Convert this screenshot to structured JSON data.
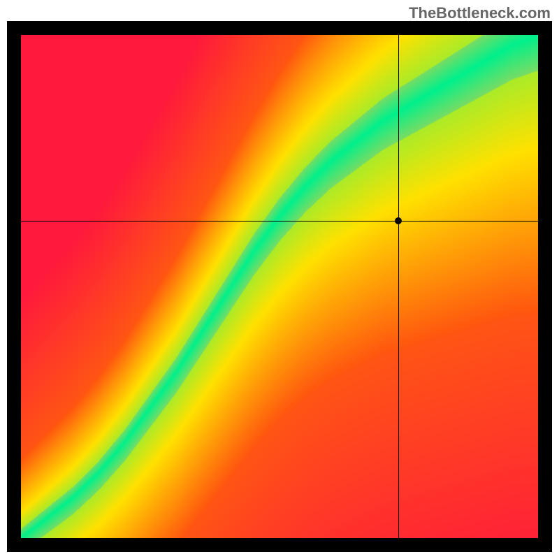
{
  "watermark": "TheBottleneck.com",
  "chart_data": {
    "type": "heatmap",
    "title": "",
    "xlabel": "",
    "ylabel": "",
    "x_range": [
      0,
      100
    ],
    "y_range": [
      0,
      100
    ],
    "grid": false,
    "legend": false,
    "marker": {
      "x": 73.0,
      "y": 63.0
    },
    "crosshair": {
      "x": 73.0,
      "y": 63.0
    },
    "colormap_description": "Cells colored red-yellow-green by proximity to an S-shaped optimal curve from (0,0) to (100,100); green = near curve, red = far, yellow = intermediate.",
    "optimal_curve_samples": [
      {
        "x": 0,
        "y": 0
      },
      {
        "x": 5,
        "y": 4
      },
      {
        "x": 10,
        "y": 8
      },
      {
        "x": 15,
        "y": 13
      },
      {
        "x": 20,
        "y": 19
      },
      {
        "x": 25,
        "y": 26
      },
      {
        "x": 30,
        "y": 33
      },
      {
        "x": 35,
        "y": 41
      },
      {
        "x": 40,
        "y": 49
      },
      {
        "x": 45,
        "y": 57
      },
      {
        "x": 50,
        "y": 64
      },
      {
        "x": 55,
        "y": 70
      },
      {
        "x": 60,
        "y": 75
      },
      {
        "x": 65,
        "y": 79
      },
      {
        "x": 70,
        "y": 83
      },
      {
        "x": 75,
        "y": 86
      },
      {
        "x": 80,
        "y": 89
      },
      {
        "x": 85,
        "y": 92
      },
      {
        "x": 90,
        "y": 95
      },
      {
        "x": 95,
        "y": 98
      },
      {
        "x": 100,
        "y": 100
      }
    ]
  },
  "layout": {
    "inner_left": 30,
    "inner_top": 50,
    "inner_width": 740,
    "inner_height": 720
  }
}
